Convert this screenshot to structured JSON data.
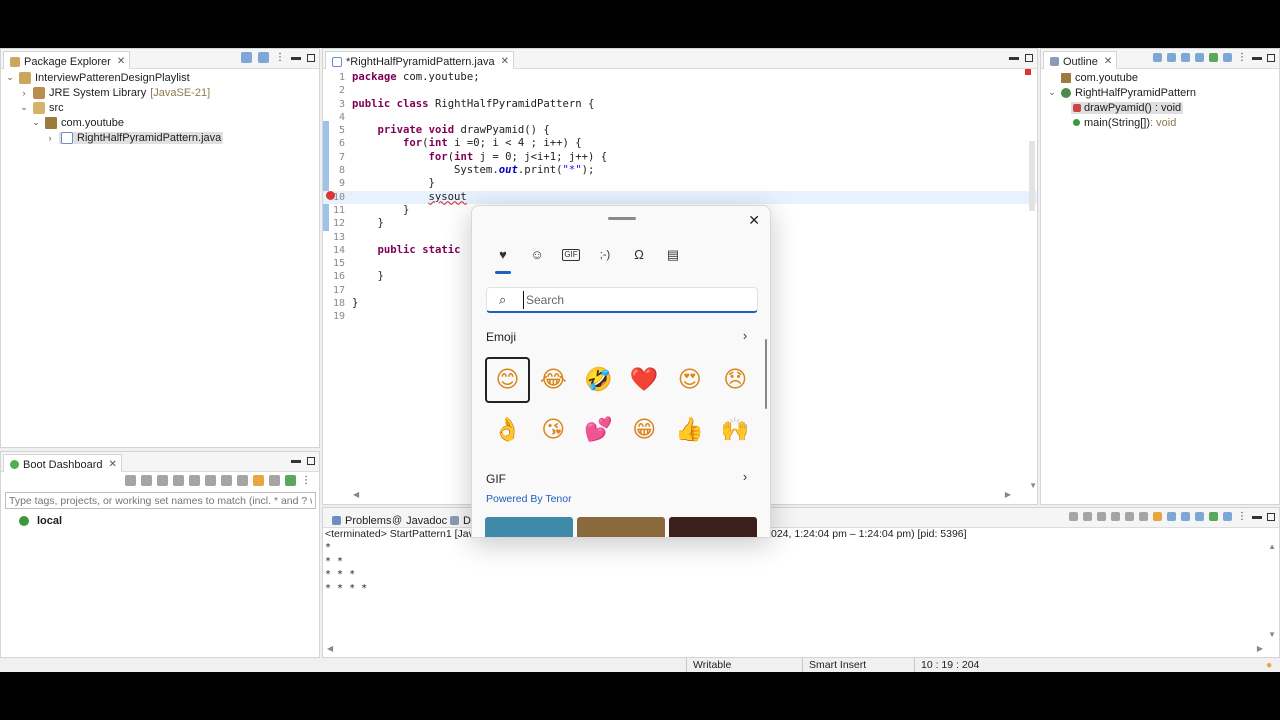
{
  "package_explorer": {
    "title": "Package Explorer",
    "items": [
      {
        "label": "InterviewPatterenDesignPlaylist"
      },
      {
        "label": "JRE System Library",
        "suffix": "[JavaSE-21]"
      },
      {
        "label": "src"
      },
      {
        "label": "com.youtube"
      },
      {
        "label": "RightHalfPyramidPattern.java"
      }
    ]
  },
  "boot_dashboard": {
    "title": "Boot Dashboard",
    "filter_placeholder": "Type tags, projects, or working set names to match (incl. * and ? wildc",
    "local_label": "local"
  },
  "editor": {
    "tab_title": "*RightHalfPyramidPattern.java",
    "lines": [
      {
        "n": "1",
        "code": "package com.youtube;"
      },
      {
        "n": "2",
        "code": ""
      },
      {
        "n": "3",
        "code": "public class RightHalfPyramidPattern {"
      },
      {
        "n": "4",
        "code": ""
      },
      {
        "n": "5",
        "code": "    private void drawPyamid() {"
      },
      {
        "n": "6",
        "code": "        for(int i =0; i < 4 ; i++) {"
      },
      {
        "n": "7",
        "code": "            for(int j = 0; j<i+1; j++) {"
      },
      {
        "n": "8",
        "code": "                System.out.print(\"*\");"
      },
      {
        "n": "9",
        "code": "            }"
      },
      {
        "n": "10",
        "code": "            sysout"
      },
      {
        "n": "11",
        "code": "        }"
      },
      {
        "n": "12",
        "code": "    }"
      },
      {
        "n": "13",
        "code": ""
      },
      {
        "n": "14",
        "code": "    public static"
      },
      {
        "n": "15",
        "code": ""
      },
      {
        "n": "16",
        "code": "    }"
      },
      {
        "n": "17",
        "code": ""
      },
      {
        "n": "18",
        "code": "}"
      },
      {
        "n": "19",
        "code": ""
      }
    ]
  },
  "outline": {
    "title": "Outline",
    "items": [
      {
        "label": "com.youtube"
      },
      {
        "label": "RightHalfPyramidPattern"
      },
      {
        "label": "drawPyamid()",
        "type": " : void"
      },
      {
        "label": "main(String[])",
        "type": " : void"
      }
    ]
  },
  "emoji_picker": {
    "search_placeholder": "Search",
    "emoji_section": "Emoji",
    "gif_section": "GIF",
    "powered_by": "Powered By Tenor",
    "category_icons": [
      "favorites-icon",
      "emoji-icon",
      "gif-icon",
      "kaomoji-icon",
      "symbols-icon",
      "clipboard-icon"
    ],
    "emojis": [
      "😊",
      "😂",
      "🤣",
      "❤️",
      "😍",
      "😞",
      "👌",
      "😘",
      "💕",
      "😁",
      "👍",
      "🙌"
    ],
    "accent_color": "#1f5fbf"
  },
  "console": {
    "tabs": [
      "Problems",
      "Javadoc",
      "Dec"
    ],
    "header_left": "<terminated> StartPattern1 [Java",
    "header_right": "024, 1:24:04 pm – 1:24:04 pm) [pid: 5396]",
    "output": [
      "*",
      "* *",
      "* * *",
      "* * * *"
    ]
  },
  "status_bar": {
    "writable": "Writable",
    "insert_mode": "Smart Insert",
    "position": "10 : 19 : 204"
  }
}
